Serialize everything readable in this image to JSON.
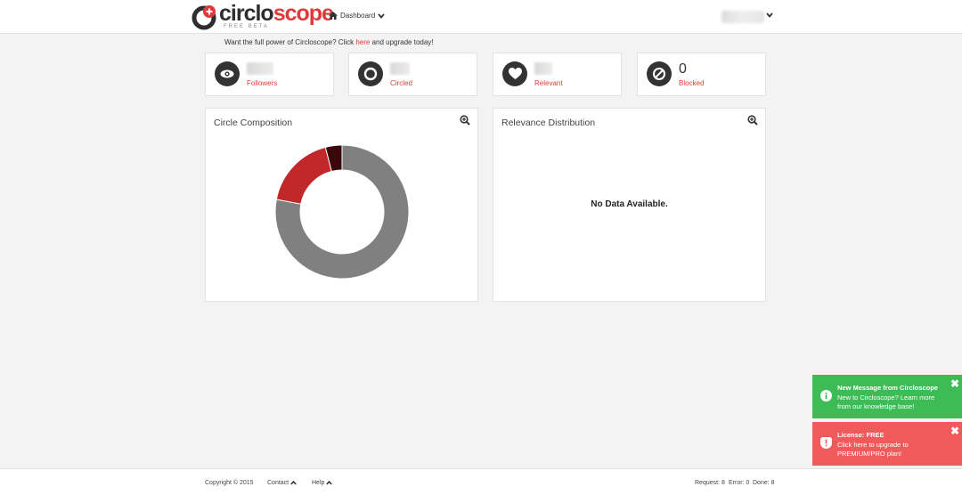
{
  "header": {
    "logo_primary": "circlo",
    "logo_accent": "scope",
    "logo_sub": "FREE BETA",
    "nav_dashboard": "Dashboard"
  },
  "promo": {
    "before": "Want the full power of Circloscope? Click ",
    "link": "here",
    "after": " and upgrade today!"
  },
  "stats": [
    {
      "label": "Followers",
      "icon": "eye-icon",
      "value": ""
    },
    {
      "label": "Circled",
      "icon": "circle-icon",
      "value": ""
    },
    {
      "label": "Relevant",
      "icon": "heart-icon",
      "value": ""
    },
    {
      "label": "Blocked",
      "icon": "blocked-icon",
      "value": "0"
    }
  ],
  "panels": {
    "composition": {
      "title": "Circle Composition"
    },
    "relevance": {
      "title": "Relevance Distribution",
      "empty_text": "No Data Available."
    }
  },
  "chart_data": {
    "type": "pie",
    "title": "Circle Composition",
    "slices": [
      {
        "value": 78,
        "color": "#808080"
      },
      {
        "value": 18,
        "color": "#c0282a"
      },
      {
        "value": 4,
        "color": "#3a0808"
      }
    ],
    "donut": true
  },
  "footer": {
    "copyright": "Copyright © 2015",
    "contact": "Contact",
    "help": "Help",
    "request": "Request: 8",
    "error": "Error: 0",
    "done": "Done: 8"
  },
  "notifications": [
    {
      "title": "New Message from Circloscope",
      "body": "New to Circloscope? Learn more from our knowledge base!",
      "color": "#3dbb55",
      "icon": "info-icon"
    },
    {
      "title": "License: FREE",
      "body": "Click here to upgrade to PREMIUM/PRO plan!",
      "color": "#f05a5a",
      "icon": "alert-shield-icon"
    }
  ],
  "colors": {
    "accent": "#e0393b",
    "background": "#f3f3f3"
  }
}
